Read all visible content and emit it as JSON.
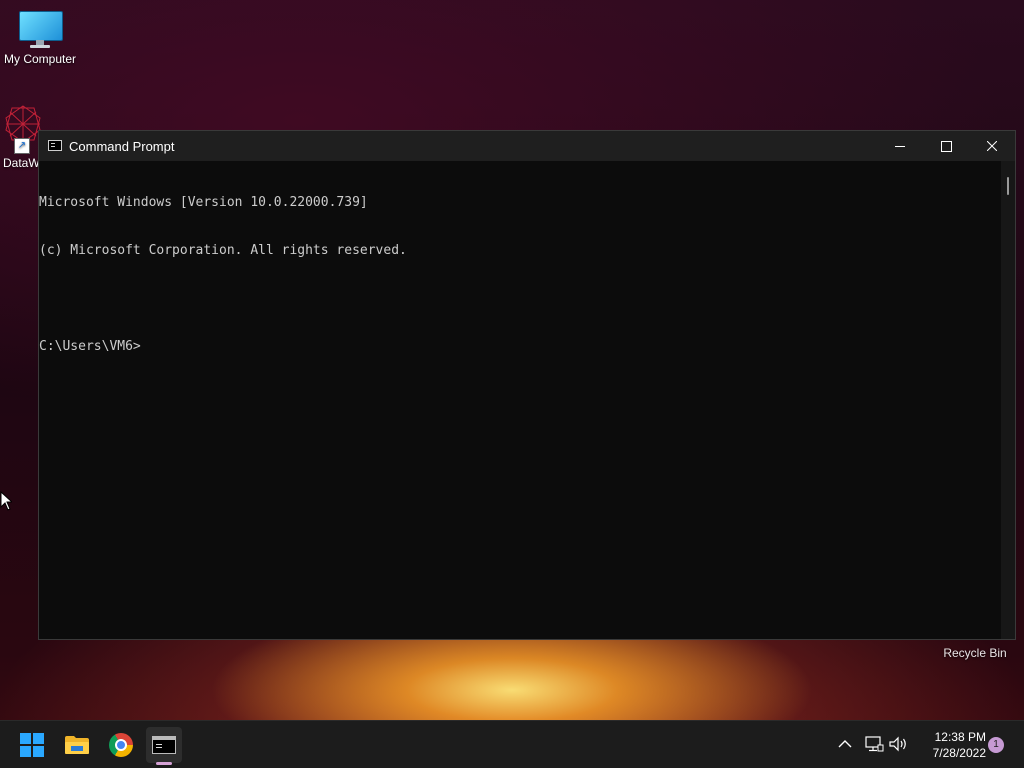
{
  "desktop": {
    "icons": [
      {
        "label": "My Computer"
      },
      {
        "label": "DataW"
      }
    ],
    "recycle_bin_label": "Recycle Bin"
  },
  "window": {
    "title": "Command Prompt",
    "controls": {
      "minimize": "minimize",
      "maximize": "maximize",
      "close": "close"
    }
  },
  "console": {
    "lines": [
      "Microsoft Windows [Version 10.0.22000.739]",
      "(c) Microsoft Corporation. All rights reserved.",
      "",
      "C:\\Users\\VM6>"
    ],
    "text_color": "#cccccc",
    "background": "#0c0c0c"
  },
  "taskbar": {
    "apps": [
      {
        "name": "start",
        "icon": "windows-logo-icon"
      },
      {
        "name": "file-explorer",
        "icon": "folder-icon"
      },
      {
        "name": "chrome",
        "icon": "chrome-icon"
      },
      {
        "name": "command-prompt",
        "icon": "cmd-icon",
        "active": true
      }
    ],
    "tray": {
      "time": "12:38 PM",
      "date": "7/28/2022",
      "notification_count": "1"
    }
  }
}
